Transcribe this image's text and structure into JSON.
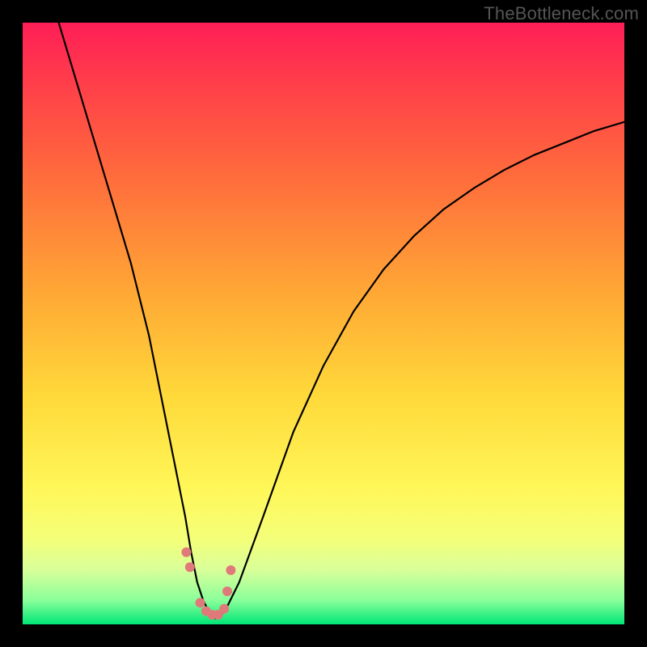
{
  "watermark": "TheBottleneck.com",
  "chart_data": {
    "type": "line",
    "title": "",
    "xlabel": "",
    "ylabel": "",
    "xlim": [
      0,
      100
    ],
    "ylim": [
      0,
      100
    ],
    "series": [
      {
        "name": "bottleneck-curve",
        "x": [
          6,
          9,
          12,
          15,
          18,
          21,
          23,
          25,
          27,
          28,
          29,
          30,
          31,
          32,
          33,
          34,
          36,
          40,
          45,
          50,
          55,
          60,
          65,
          70,
          75,
          80,
          85,
          90,
          95,
          100
        ],
        "values": [
          100,
          90,
          80,
          70,
          60,
          48,
          38,
          28,
          18,
          12,
          7,
          4,
          2,
          1,
          1.5,
          3,
          7,
          18,
          32,
          43,
          52,
          59,
          64.5,
          69,
          72.5,
          75.5,
          78,
          80,
          82,
          83.5
        ]
      }
    ],
    "markers": {
      "name": "highlight-points",
      "x": [
        27.2,
        27.8,
        29.5,
        30.5,
        31.5,
        32.5,
        33.5,
        34.0,
        34.6
      ],
      "values": [
        12.0,
        9.5,
        3.6,
        2.2,
        1.6,
        1.6,
        2.6,
        5.5,
        9.0
      ],
      "color": "#e07a7a",
      "radius_px": 6
    },
    "background": {
      "type": "vertical-gradient",
      "stops": [
        {
          "pos": 0.0,
          "color": "#ff1e56"
        },
        {
          "pos": 0.1,
          "color": "#ff3e4a"
        },
        {
          "pos": 0.25,
          "color": "#ff6a3c"
        },
        {
          "pos": 0.45,
          "color": "#ffa835"
        },
        {
          "pos": 0.62,
          "color": "#ffd93a"
        },
        {
          "pos": 0.78,
          "color": "#fff85a"
        },
        {
          "pos": 0.86,
          "color": "#f4ff7a"
        },
        {
          "pos": 0.91,
          "color": "#d8ff9a"
        },
        {
          "pos": 0.96,
          "color": "#8aff9a"
        },
        {
          "pos": 1.0,
          "color": "#00e676"
        }
      ]
    }
  }
}
